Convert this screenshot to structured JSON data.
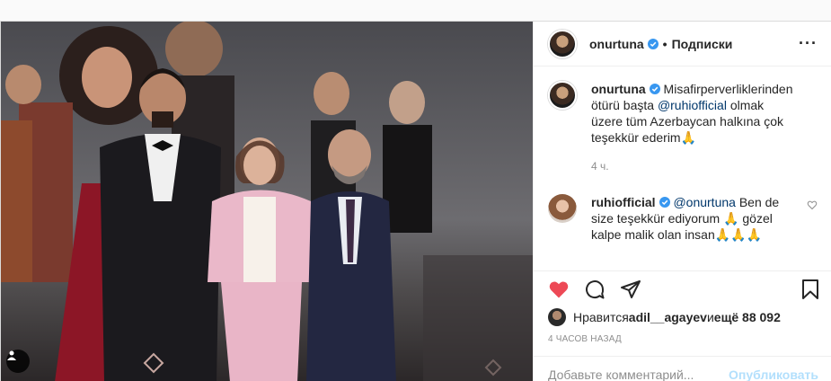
{
  "post": {
    "author": "onurtuna",
    "follow_label": "Подписки",
    "dot": "•",
    "more_icon": "more-horizontal-icon"
  },
  "comments": [
    {
      "user": "onurtuna",
      "text_before": " Misafirperverliklerinden ötürü başta ",
      "mention": "@ruhiofficial",
      "text_after": " olmak üzere tüm Azerbaycan halkına çok teşekkür ederim🙏",
      "time": "4 ч."
    },
    {
      "user": "ruhiofficial",
      "mention": "@onurtuna",
      "text_after": " Ben de size teşekkür ediyorum 🙏 gözel kalpe malik olan insan🙏🙏🙏"
    }
  ],
  "likes": {
    "prefix": "Нравится ",
    "user": "adil__agayev",
    "middle": " и ",
    "count_text": "ещё 88 092"
  },
  "time_ago": "4 ЧАСОВ НАЗАД",
  "add_comment": {
    "placeholder": "Добавьте комментарий...",
    "publish_label": "Опубликовать"
  },
  "colors": {
    "like_red": "#ed4956",
    "verified_blue": "#3897f0",
    "mention": "#00376b",
    "muted": "#8e8e8e"
  }
}
